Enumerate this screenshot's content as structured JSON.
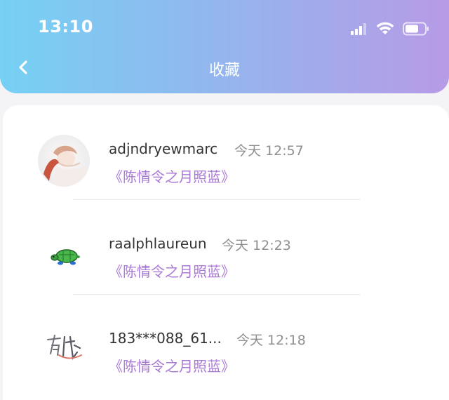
{
  "status_bar": {
    "time": "13:10"
  },
  "nav": {
    "title": "收藏",
    "back_icon": "chevron-left-icon"
  },
  "colors": {
    "gradient_start": "#76d1f3",
    "gradient_end": "#b79be6",
    "title_accent": "#a979d6",
    "meta_text": "#8f8f8f"
  },
  "favorites": [
    {
      "username": "adjndryewmarc",
      "time": "今天 12:57",
      "title": "《陈情令之月照蓝》",
      "avatar": "illustrated-girl-avatar"
    },
    {
      "username": "raalphlaureun",
      "time": "今天 12:23",
      "title": "《陈情令之月照蓝》",
      "avatar": "turtle-avatar"
    },
    {
      "username": "183***088_61...",
      "time": "今天 12:18",
      "title": "《陈情令之月照蓝》",
      "avatar": "calligraphy-avatar"
    }
  ]
}
